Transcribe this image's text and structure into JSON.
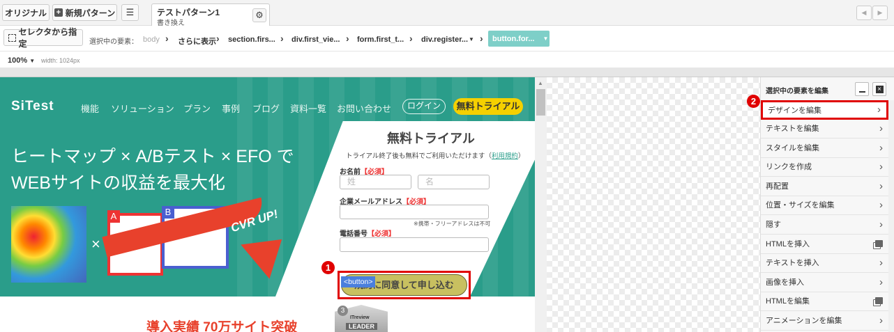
{
  "toolbar": {
    "original_label": "オリジナル",
    "new_pattern_label": "新規パターン",
    "pattern_tab": {
      "title": "テストパターン1",
      "subtitle": "書き換え"
    }
  },
  "breadcrumb": {
    "selector_button": "セレクタから指定",
    "selected_label": "選択中の要素：",
    "items": [
      "body",
      "さらに表示",
      "section.firs...",
      "div.first_vie...",
      "form.first_t...",
      "div.register...",
      "button.for..."
    ]
  },
  "zoom": {
    "level": "100%",
    "width": "width: 1024px"
  },
  "site": {
    "logo": "SiTest",
    "nav": [
      "機能",
      "ソリューション",
      "プラン",
      "事例",
      "ブログ",
      "資料一覧",
      "お問い合わせ"
    ],
    "login": "ログイン",
    "trial": "無料トライアル",
    "headline_1": "ヒートマップ × A/Bテスト × EFO で",
    "headline_2": "WEBサイトの収益を最大化",
    "cvr": "CVR UP!",
    "times": "×",
    "a_label": "A",
    "b_label": "B",
    "form": {
      "title": "無料トライアル",
      "note_before": "トライアル終了後も無料でご利用いただけます（",
      "note_link": "利用規約",
      "note_after": "）",
      "name_label": "お名前",
      "required": "【必須】",
      "last_placeholder": "姓",
      "first_placeholder": "名",
      "email_label": "企業メールアドレス",
      "email_note": "※携帯・フリーアドレスは不可",
      "phone_label": "電話番号",
      "submit": "規約に同意して申し込む",
      "tag": "<button>"
    },
    "achievement": "導入実績 70万サイト突破",
    "badge_number": "3",
    "badge_text": "LEADER",
    "badge_brand": "ITreview"
  },
  "markers": {
    "one": "1",
    "two": "2"
  },
  "panel": {
    "title": "選択中の要素を編集",
    "items": [
      {
        "label": "デザインを編集",
        "icon": "chevron-right-icon",
        "highlighted": true
      },
      {
        "label": "テキストを編集",
        "icon": "chevron-right-icon"
      },
      {
        "label": "スタイルを編集",
        "icon": "chevron-right-icon"
      },
      {
        "label": "リンクを作成",
        "icon": "chevron-right-icon"
      },
      {
        "label": "再配置",
        "icon": "chevron-right-icon"
      },
      {
        "label": "位置・サイズを編集",
        "icon": "chevron-right-icon"
      },
      {
        "label": "隠す",
        "icon": "chevron-right-icon"
      },
      {
        "label": "HTMLを挿入",
        "icon": "copy-icon"
      },
      {
        "label": "テキストを挿入",
        "icon": "chevron-right-icon"
      },
      {
        "label": "画像を挿入",
        "icon": "chevron-right-icon"
      },
      {
        "label": "HTMLを編集",
        "icon": "copy-icon"
      },
      {
        "label": "アニメーションを編集",
        "icon": "chevron-right-icon"
      }
    ]
  },
  "colors": {
    "teal": "#2a9d8a",
    "accent_teal": "#7ecfc8",
    "highlight_red": "#e00000",
    "trial_yellow": "#f5d000",
    "button_olive": "#c8c060",
    "cta_red": "#e8412c"
  }
}
